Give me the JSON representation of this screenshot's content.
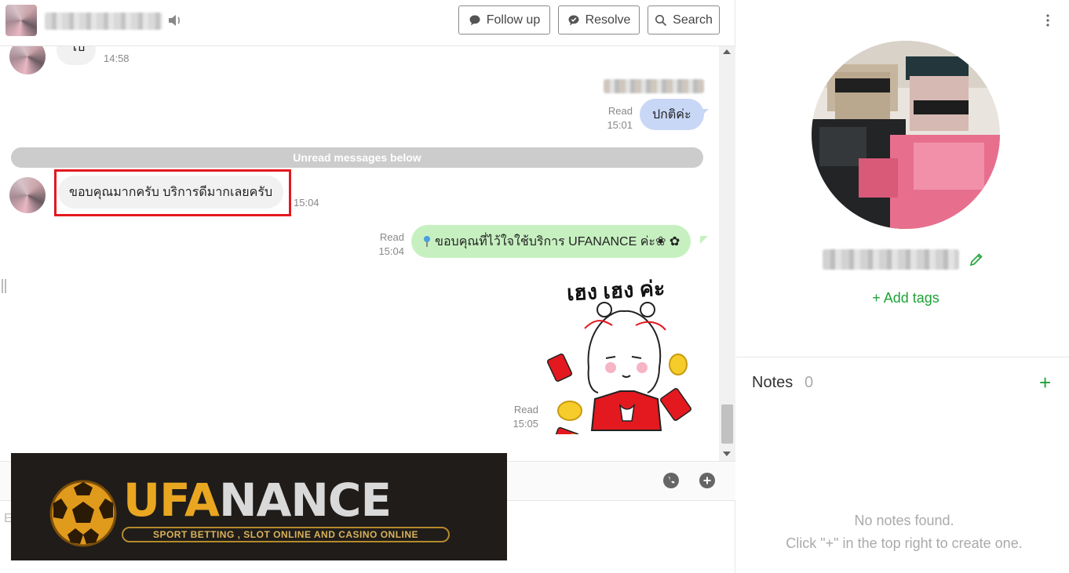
{
  "header": {
    "follow_up_label": "Follow up",
    "resolve_label": "Resolve",
    "search_label": "Search"
  },
  "messages": {
    "first": {
      "text": "ไป",
      "time": "14:58"
    },
    "outgoing_1": {
      "text": "ปกติค่ะ",
      "status": "Read",
      "time": "15:01"
    },
    "unread_divider": "Unread messages below",
    "incoming_1": {
      "text": "ขอบคุณมากครับ บริการดีมากเลยครับ",
      "time": "15:04"
    },
    "outgoing_2": {
      "text": "ขอบคุณที่ไว้ใจใช้บริการ UFANANCE ค่ะ❀ ✿",
      "status": "Read",
      "time": "15:04"
    },
    "sticker": {
      "caption": "เฮง เฮง ค่ะ",
      "status": "Read",
      "time": "15:05"
    }
  },
  "composer": {
    "placeholder": "E"
  },
  "banner": {
    "brand_gold": "UFA",
    "brand_rest": "NANCE",
    "tagline": "SPORT BETTING , SLOT ONLINE AND CASINO ONLINE"
  },
  "profile": {
    "add_tags_label": "+ Add tags"
  },
  "notes": {
    "title": "Notes",
    "count": "0",
    "add_label": "+",
    "empty_line1": "No notes found.",
    "empty_line2": "Click \"+\" in the top right to create one."
  },
  "colors": {
    "accent_green": "#1ea235",
    "highlight_red": "#e3191f",
    "outgoing_blue": "#c8d7f6",
    "outgoing_green": "#c7f0c1"
  }
}
